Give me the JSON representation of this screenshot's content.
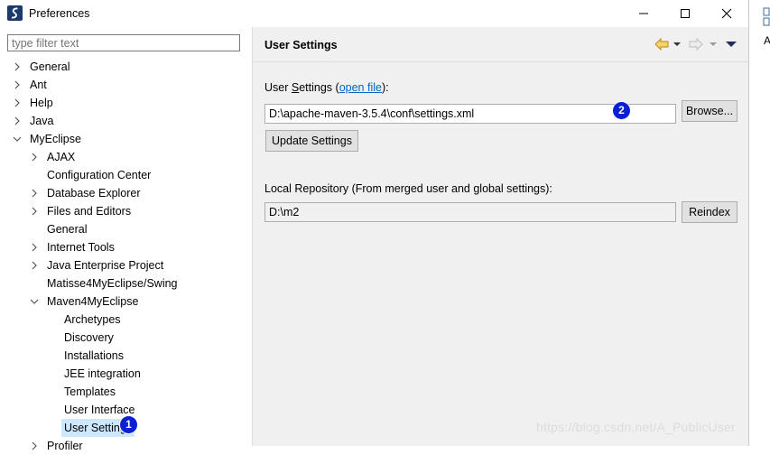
{
  "window": {
    "title": "Preferences"
  },
  "filter": {
    "placeholder": "type filter text"
  },
  "tree": [
    {
      "label": "General",
      "level": 0,
      "arrow": "collapsed"
    },
    {
      "label": "Ant",
      "level": 0,
      "arrow": "collapsed"
    },
    {
      "label": "Help",
      "level": 0,
      "arrow": "collapsed"
    },
    {
      "label": "Java",
      "level": 0,
      "arrow": "collapsed"
    },
    {
      "label": "MyEclipse",
      "level": 0,
      "arrow": "expanded"
    },
    {
      "label": "AJAX",
      "level": 1,
      "arrow": "collapsed"
    },
    {
      "label": "Configuration Center",
      "level": 1,
      "arrow": "none"
    },
    {
      "label": "Database Explorer",
      "level": 1,
      "arrow": "collapsed"
    },
    {
      "label": "Files and Editors",
      "level": 1,
      "arrow": "collapsed"
    },
    {
      "label": "General",
      "level": 1,
      "arrow": "none"
    },
    {
      "label": "Internet Tools",
      "level": 1,
      "arrow": "collapsed"
    },
    {
      "label": "Java Enterprise Project",
      "level": 1,
      "arrow": "collapsed"
    },
    {
      "label": "Matisse4MyEclipse/Swing",
      "level": 1,
      "arrow": "none"
    },
    {
      "label": "Maven4MyEclipse",
      "level": 1,
      "arrow": "expanded"
    },
    {
      "label": "Archetypes",
      "level": 2,
      "arrow": "none"
    },
    {
      "label": "Discovery",
      "level": 2,
      "arrow": "none"
    },
    {
      "label": "Installations",
      "level": 2,
      "arrow": "none"
    },
    {
      "label": "JEE integration",
      "level": 2,
      "arrow": "none"
    },
    {
      "label": "Templates",
      "level": 2,
      "arrow": "none"
    },
    {
      "label": "User Interface",
      "level": 2,
      "arrow": "none"
    },
    {
      "label": "User Settings",
      "level": 2,
      "arrow": "none",
      "selected": true
    },
    {
      "label": "Profiler",
      "level": 1,
      "arrow": "collapsed"
    }
  ],
  "page": {
    "title": "User Settings",
    "user_settings_label_prefix": "User ",
    "user_settings_label_mnemonic": "S",
    "user_settings_label_rest": "ettings (",
    "open_file_link": "open file",
    "user_settings_label_suffix": "):",
    "user_settings_value": "D:\\apache-maven-3.5.4\\conf\\settings.xml",
    "browse_button": "Browse...",
    "update_button": "Update Settings",
    "local_repo_label": "Local Repository (From merged user and global settings):",
    "local_repo_value": "D:\\m2",
    "reindex_button": "Reindex"
  },
  "badges": {
    "one": "1",
    "two": "2"
  },
  "watermark": "https://blog.csdn.net/A_PublicUser",
  "edge_letter": "A",
  "colors": {
    "selection": "#cce8ff",
    "link": "#0066cc",
    "badge": "#0a1fd6"
  }
}
